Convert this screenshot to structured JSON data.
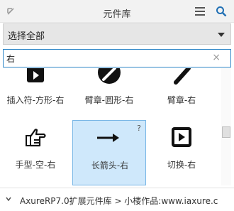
{
  "header": {
    "title": "元件库",
    "collapse_icon": "collapse-arrow-icon",
    "menu_icon": "hamburger-menu-icon",
    "search_icon": "search-icon"
  },
  "library_select": {
    "value": "选择全部"
  },
  "search": {
    "value": "右",
    "clear_icon": "close-icon"
  },
  "widgets": [
    {
      "label": "插入符-方形-右",
      "icon": "caret-square-right-icon"
    },
    {
      "label": "臂章-圆形-右",
      "icon": "badge-circle-right-icon"
    },
    {
      "label": "臂章-右",
      "icon": "badge-right-icon"
    },
    {
      "label": "手型-空-右",
      "icon": "hand-point-right-icon"
    },
    {
      "label": "长箭头-右",
      "icon": "long-arrow-right-icon",
      "selected": true,
      "help": "?"
    },
    {
      "label": "切换-右",
      "icon": "toggle-right-icon"
    }
  ],
  "footer": {
    "text": "AxureRP7.0扩展元件库 > 小楼作品:www.iaxure.c"
  },
  "colors": {
    "accent": "#2f87c7",
    "selected_bg": "#cfe8fb"
  }
}
